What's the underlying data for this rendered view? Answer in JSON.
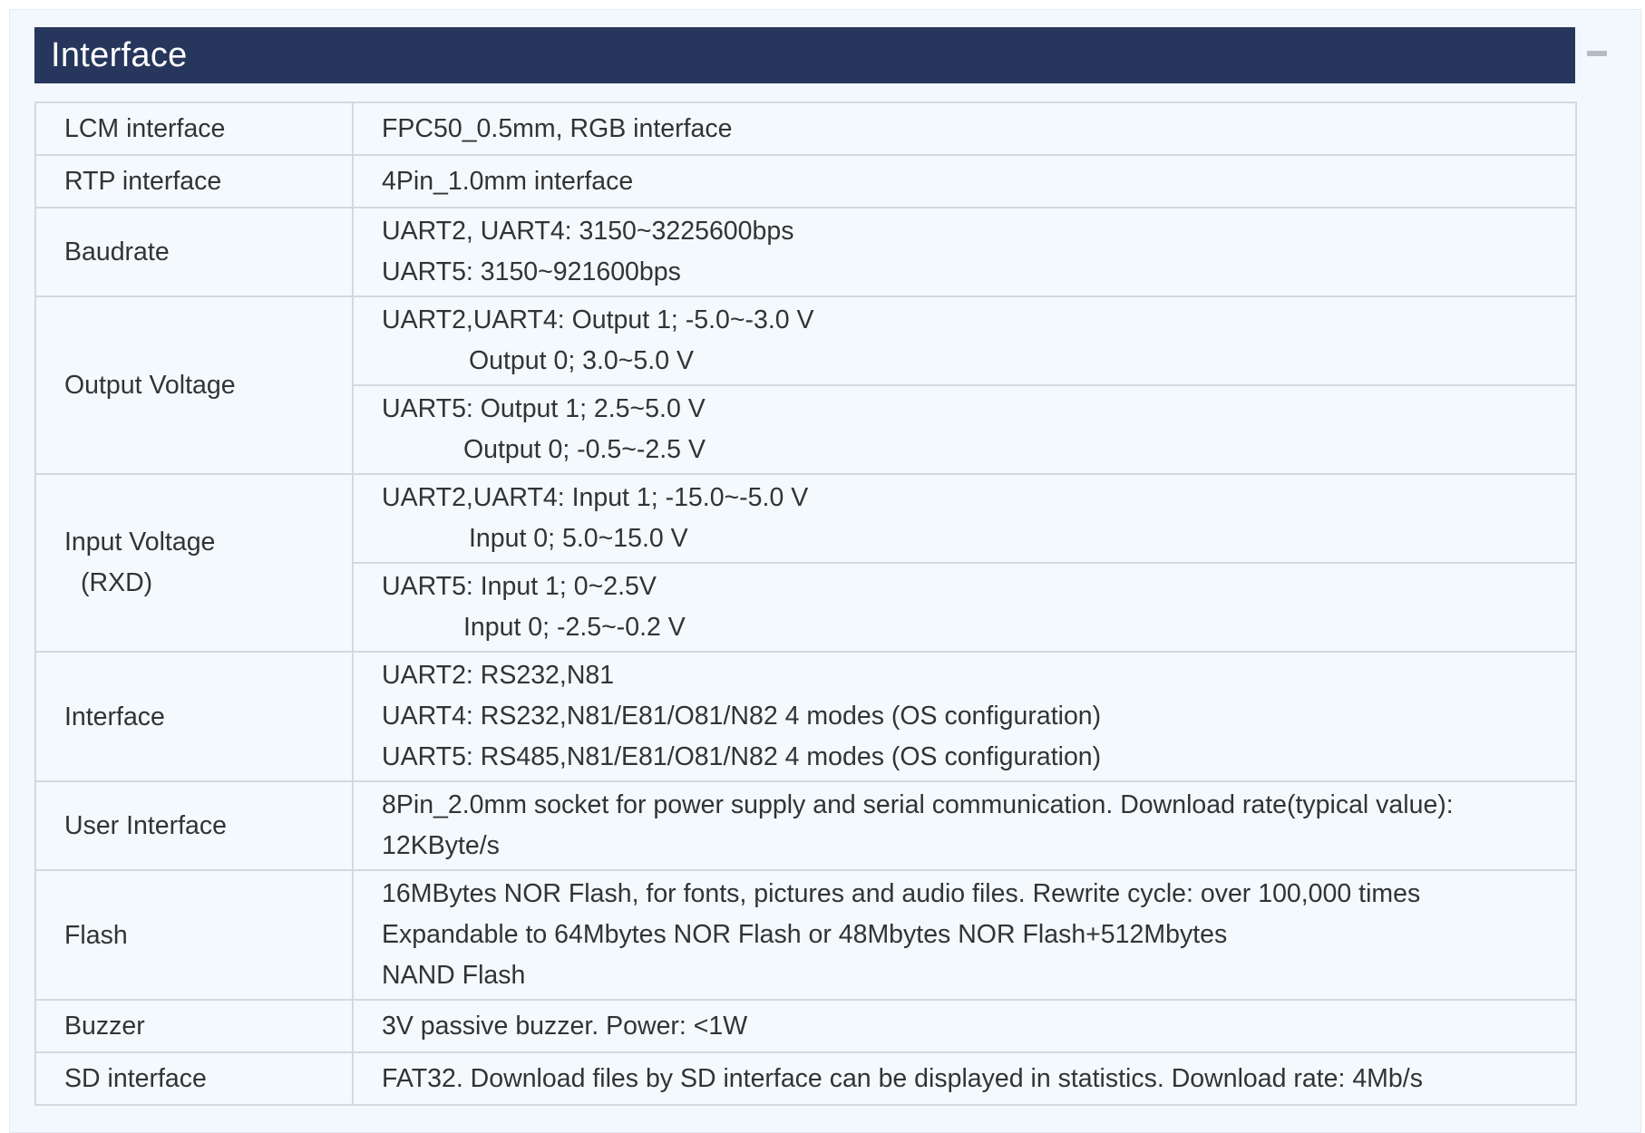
{
  "section": {
    "title": "Interface",
    "collapse_icon": "minus-icon"
  },
  "rows": {
    "lcm": {
      "label": "LCM interface",
      "value": "FPC50_0.5mm, RGB interface"
    },
    "rtp": {
      "label": "RTP interface",
      "value": "4Pin_1.0mm interface"
    },
    "baudrate": {
      "label": "Baudrate",
      "line1": "UART2, UART4: 3150~3225600bps",
      "line2": "UART5: 3150~921600bps"
    },
    "output_voltage": {
      "label": "Output Voltage",
      "a_line1": "UART2,UART4: Output 1; -5.0~-3.0 V",
      "a_line2": "Output 0; 3.0~5.0 V",
      "b_line1": "UART5: Output 1; 2.5~5.0 V",
      "b_line2": "Output 0; -0.5~-2.5 V"
    },
    "input_voltage": {
      "label": "Input Voltage",
      "label_sub": "(RXD)",
      "a_line1": "UART2,UART4: Input 1; -15.0~-5.0 V",
      "a_line2": "Input 0; 5.0~15.0 V",
      "b_line1": "UART5: Input 1; 0~2.5V",
      "b_line2": "Input 0; -2.5~-0.2 V"
    },
    "interface": {
      "label": "Interface",
      "line1": "UART2: RS232,N81",
      "line2": "UART4: RS232,N81/E81/O81/N82 4 modes (OS configuration)",
      "line3": "UART5: RS485,N81/E81/O81/N82 4 modes (OS configuration)"
    },
    "user_interface": {
      "label": "User Interface",
      "line1": "8Pin_2.0mm socket for power supply and serial communication. Download rate(typical value):",
      "line2": "12KByte/s"
    },
    "flash": {
      "label": "Flash",
      "line1": "16MBytes NOR Flash, for fonts, pictures and audio files. Rewrite cycle: over 100,000 times",
      "line2": "Expandable to 64Mbytes NOR Flash or 48Mbytes NOR Flash+512Mbytes",
      "line3": "NAND Flash"
    },
    "buzzer": {
      "label": "Buzzer",
      "value": "3V passive buzzer. Power: <1W"
    },
    "sd": {
      "label": "SD interface",
      "value": "FAT32. Download files by SD interface can be displayed in statistics. Download rate: 4Mb/s"
    }
  }
}
